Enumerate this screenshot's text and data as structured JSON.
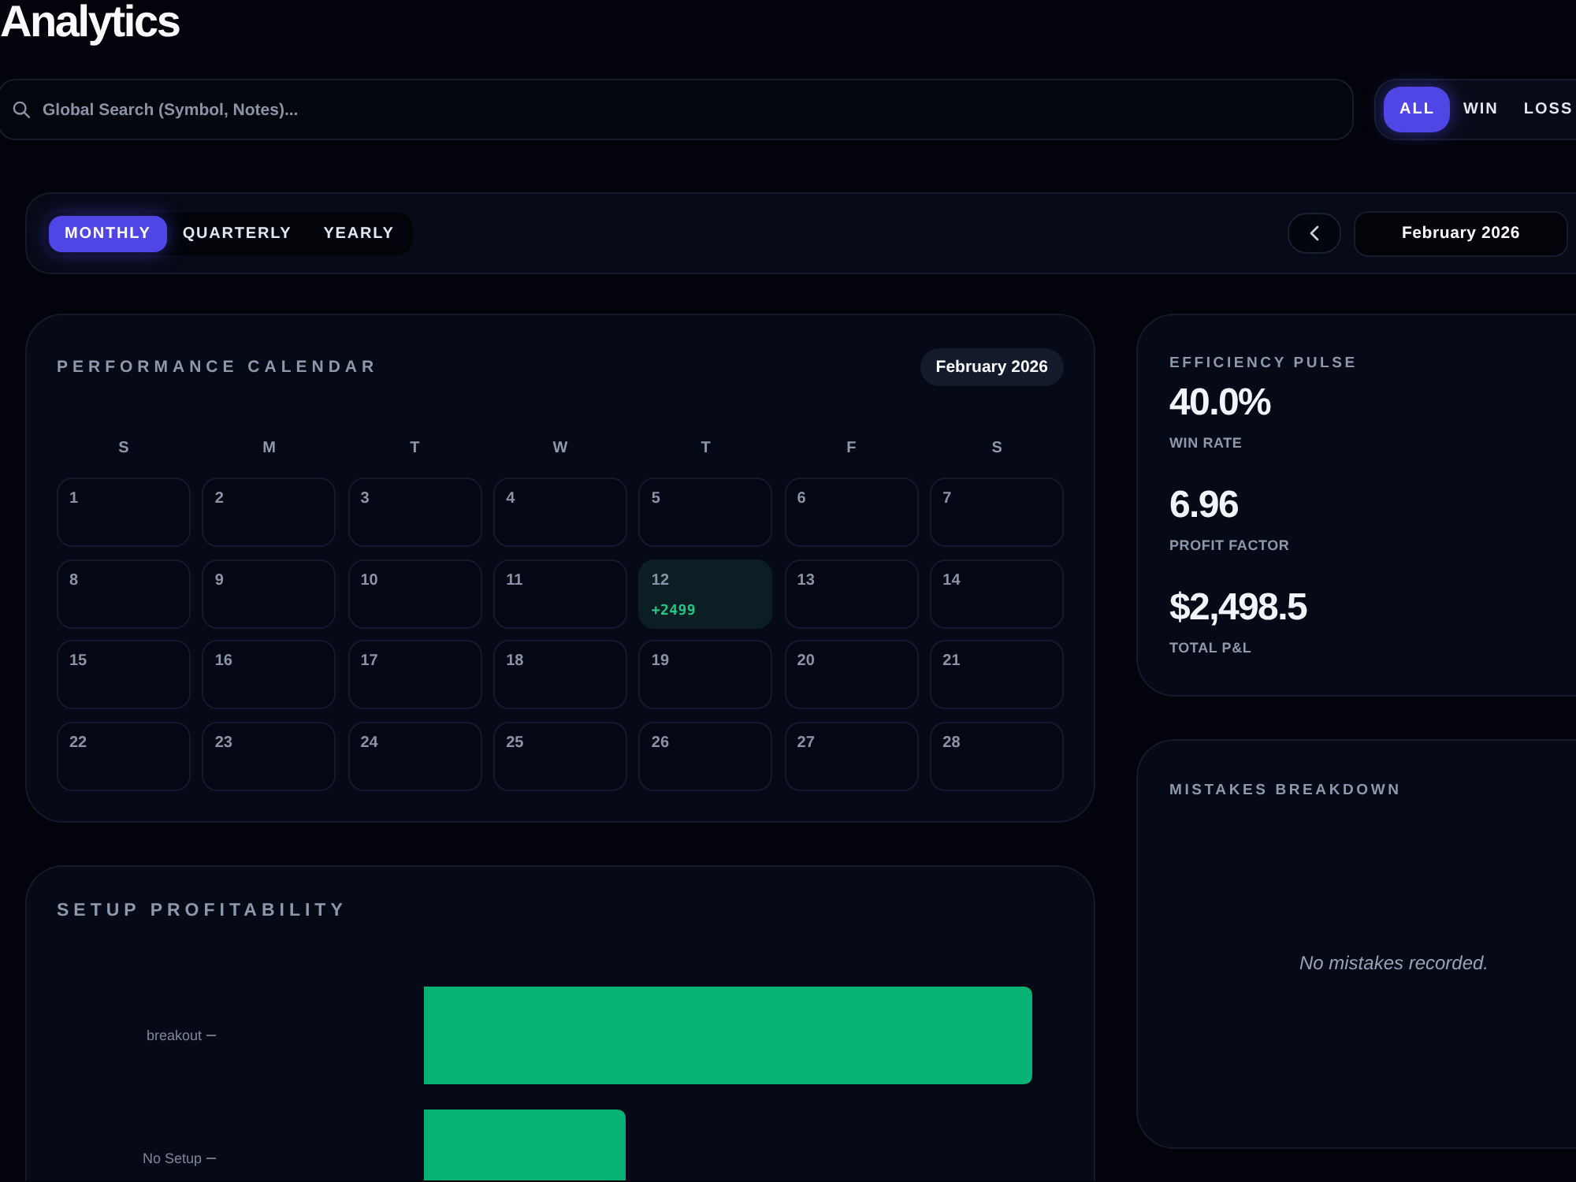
{
  "page": {
    "title": "Analytics"
  },
  "search": {
    "placeholder": "Global Search (Symbol, Notes)..."
  },
  "outcome_filter": [
    {
      "label": "ALL",
      "selected": true
    },
    {
      "label": "WIN",
      "selected": false
    },
    {
      "label": "LOSS",
      "selected": false
    }
  ],
  "period_tabs": [
    {
      "label": "MONTHLY",
      "selected": true
    },
    {
      "label": "QUARTERLY",
      "selected": false
    },
    {
      "label": "YEARLY",
      "selected": false
    }
  ],
  "period_picker": {
    "value": "February 2026"
  },
  "calendar": {
    "title": "PERFORMANCE CALENDAR",
    "month_badge": "February 2026",
    "weekdays": [
      "S",
      "M",
      "T",
      "W",
      "T",
      "F",
      "S"
    ],
    "days": [
      {
        "day": "1",
        "highlighted": false
      },
      {
        "day": "2",
        "highlighted": false
      },
      {
        "day": "3",
        "highlighted": false
      },
      {
        "day": "4",
        "highlighted": false
      },
      {
        "day": "5",
        "highlighted": false
      },
      {
        "day": "6",
        "highlighted": false
      },
      {
        "day": "7",
        "highlighted": false
      },
      {
        "day": "8",
        "highlighted": false
      },
      {
        "day": "9",
        "highlighted": false
      },
      {
        "day": "10",
        "highlighted": false
      },
      {
        "day": "11",
        "highlighted": false
      },
      {
        "day": "12",
        "pnl": "+2499",
        "highlighted": true
      },
      {
        "day": "13",
        "highlighted": false
      },
      {
        "day": "14",
        "highlighted": false
      },
      {
        "day": "15",
        "highlighted": false
      },
      {
        "day": "16",
        "highlighted": false
      },
      {
        "day": "17",
        "highlighted": false
      },
      {
        "day": "18",
        "highlighted": false
      },
      {
        "day": "19",
        "highlighted": false
      },
      {
        "day": "20",
        "highlighted": false
      },
      {
        "day": "21",
        "highlighted": false
      },
      {
        "day": "22",
        "highlighted": false
      },
      {
        "day": "23",
        "highlighted": false
      },
      {
        "day": "24",
        "highlighted": false
      },
      {
        "day": "25",
        "highlighted": false
      },
      {
        "day": "26",
        "highlighted": false
      },
      {
        "day": "27",
        "highlighted": false
      },
      {
        "day": "28",
        "highlighted": false
      }
    ]
  },
  "efficiency": {
    "title": "EFFICIENCY PULSE",
    "metrics": [
      {
        "value": "40.0%",
        "label": "WIN RATE"
      },
      {
        "value": "6.96",
        "label": "PROFIT FACTOR"
      },
      {
        "value": "$2,498.5",
        "label": "TOTAL P&L"
      }
    ]
  },
  "mistakes": {
    "title": "MISTAKES BREAKDOWN",
    "empty_message": "No mistakes recorded."
  },
  "setup_profitability": {
    "title": "SETUP PROFITABILITY",
    "bars": [
      {
        "label": "breakout"
      },
      {
        "label": "No Setup"
      }
    ]
  }
}
